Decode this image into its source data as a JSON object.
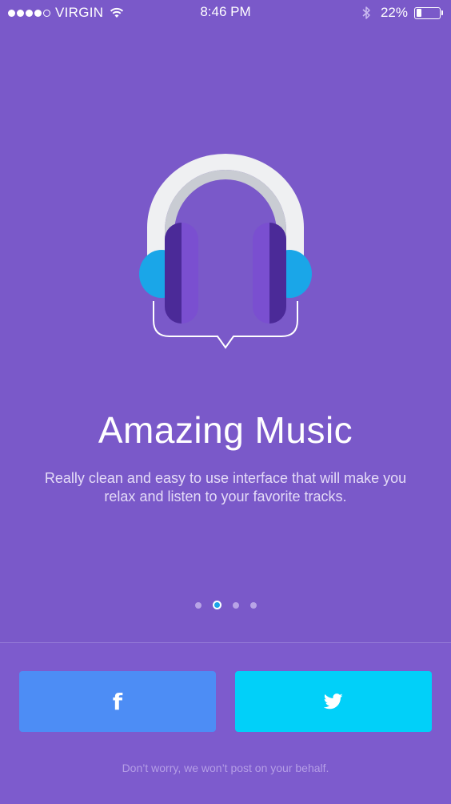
{
  "status_bar": {
    "carrier": "VIRGIN",
    "time": "8:46 PM",
    "battery_percent": "22%",
    "battery_level": 0.22,
    "signal_bars_filled": 4,
    "signal_bars_total": 5,
    "icons": [
      "signal-dots",
      "wifi-icon",
      "bluetooth-icon",
      "battery-icon"
    ]
  },
  "hero": {
    "icon": "headphones-illustration",
    "title": "Amazing Music",
    "description": "Really clean and easy to use interface that will make you relax and listen to your favorite tracks."
  },
  "pager": {
    "total": 4,
    "active_index": 1
  },
  "social": {
    "facebook": {
      "icon": "facebook-icon",
      "glyph": "f",
      "color": "#4d8df5"
    },
    "twitter": {
      "icon": "twitter-icon",
      "color": "#01d0f9"
    },
    "disclaimer": "Don’t worry, we won’t post on your behalf."
  },
  "colors": {
    "background": "#7a59c9",
    "accent": "#1aa6e8"
  }
}
